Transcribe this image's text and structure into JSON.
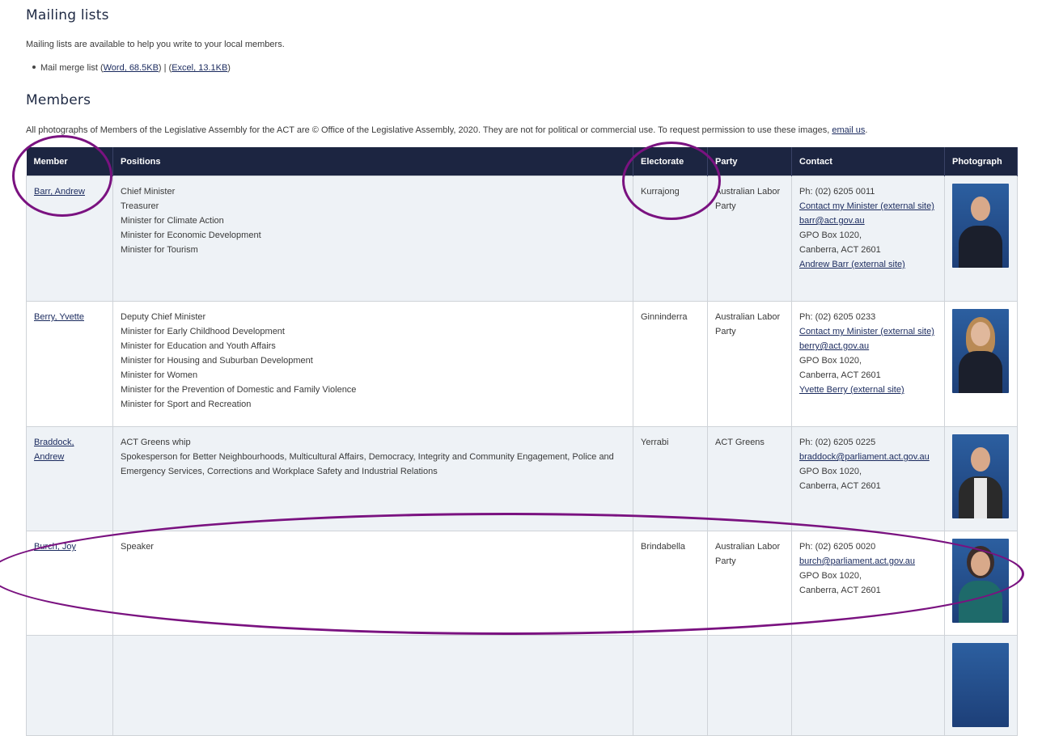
{
  "mailing": {
    "heading": "Mailing lists",
    "intro": "Mailing lists are available to help you write to your local members.",
    "item_prefix": "Mail merge list (",
    "word_link": "Word, 68.5KB",
    "separator": ") | (",
    "excel_link": "Excel, 13.1KB",
    "item_suffix": ")"
  },
  "members": {
    "heading": "Members",
    "copyright_text": "All photographs of Members of the Legislative Assembly for the ACT are © Office of the Legislative Assembly, 2020. They are not for political or commercial use. To request permission to use these images, ",
    "email_link": "email us",
    "copyright_end": "."
  },
  "table": {
    "headers": [
      "Member",
      "Positions",
      "Electorate",
      "Party",
      "Contact",
      "Photograph"
    ],
    "rows": [
      {
        "member": "Barr, Andrew",
        "positions": [
          "Chief Minister",
          "Treasurer",
          "Minister for Climate Action",
          "Minister for Economic Development",
          "Minister for Tourism"
        ],
        "electorate": "Kurrajong",
        "party": "Australian Labor Party",
        "phone": "Ph: (02) 6205 0011",
        "contact_minister": "Contact my Minister (external site)",
        "email": "barr@act.gov.au",
        "po_box": "GPO Box 1020,",
        "city": "Canberra, ACT 2601",
        "external": "Andrew Barr (external site)"
      },
      {
        "member": "Berry, Yvette",
        "positions": [
          "Deputy Chief Minister",
          "Minister for Early Childhood Development",
          "Minister for Education and Youth Affairs",
          "Minister for Housing and Suburban Development",
          "Minister for Women",
          "Minister for the Prevention of Domestic and Family Violence",
          "Minister for Sport and Recreation"
        ],
        "electorate": "Ginninderra",
        "party": "Australian Labor Party",
        "phone": "Ph: (02) 6205 0233",
        "contact_minister": "Contact my Minister (external site)",
        "email": "berry@act.gov.au",
        "po_box": "GPO Box 1020,",
        "city": "Canberra, ACT 2601",
        "external": "Yvette Berry (external site)"
      },
      {
        "member": "Braddock, Andrew",
        "positions": [
          "ACT Greens whip",
          "Spokesperson for Better Neighbourhoods, Multicultural Affairs, Democracy, Integrity and Community Engagement, Police and Emergency Services, Corrections and  Workplace Safety and Industrial Relations"
        ],
        "electorate": "Yerrabi",
        "party": "ACT Greens",
        "phone": "Ph: (02) 6205 0225",
        "email": "braddock@parliament.act.gov.au",
        "po_box": "GPO Box 1020,",
        "city": "Canberra, ACT 2601"
      },
      {
        "member": "Burch, Joy",
        "positions": [
          "Speaker"
        ],
        "electorate": "Brindabella",
        "party": "Australian Labor Party",
        "phone": "Ph: (02) 6205 0020",
        "email": "burch@parliament.act.gov.au",
        "po_box": "GPO Box 1020,",
        "city": "Canberra, ACT 2601"
      }
    ]
  },
  "colors": {
    "header_bg": "#1c2541",
    "annotation": "#7a1280",
    "row_alt": "#eef2f6"
  }
}
